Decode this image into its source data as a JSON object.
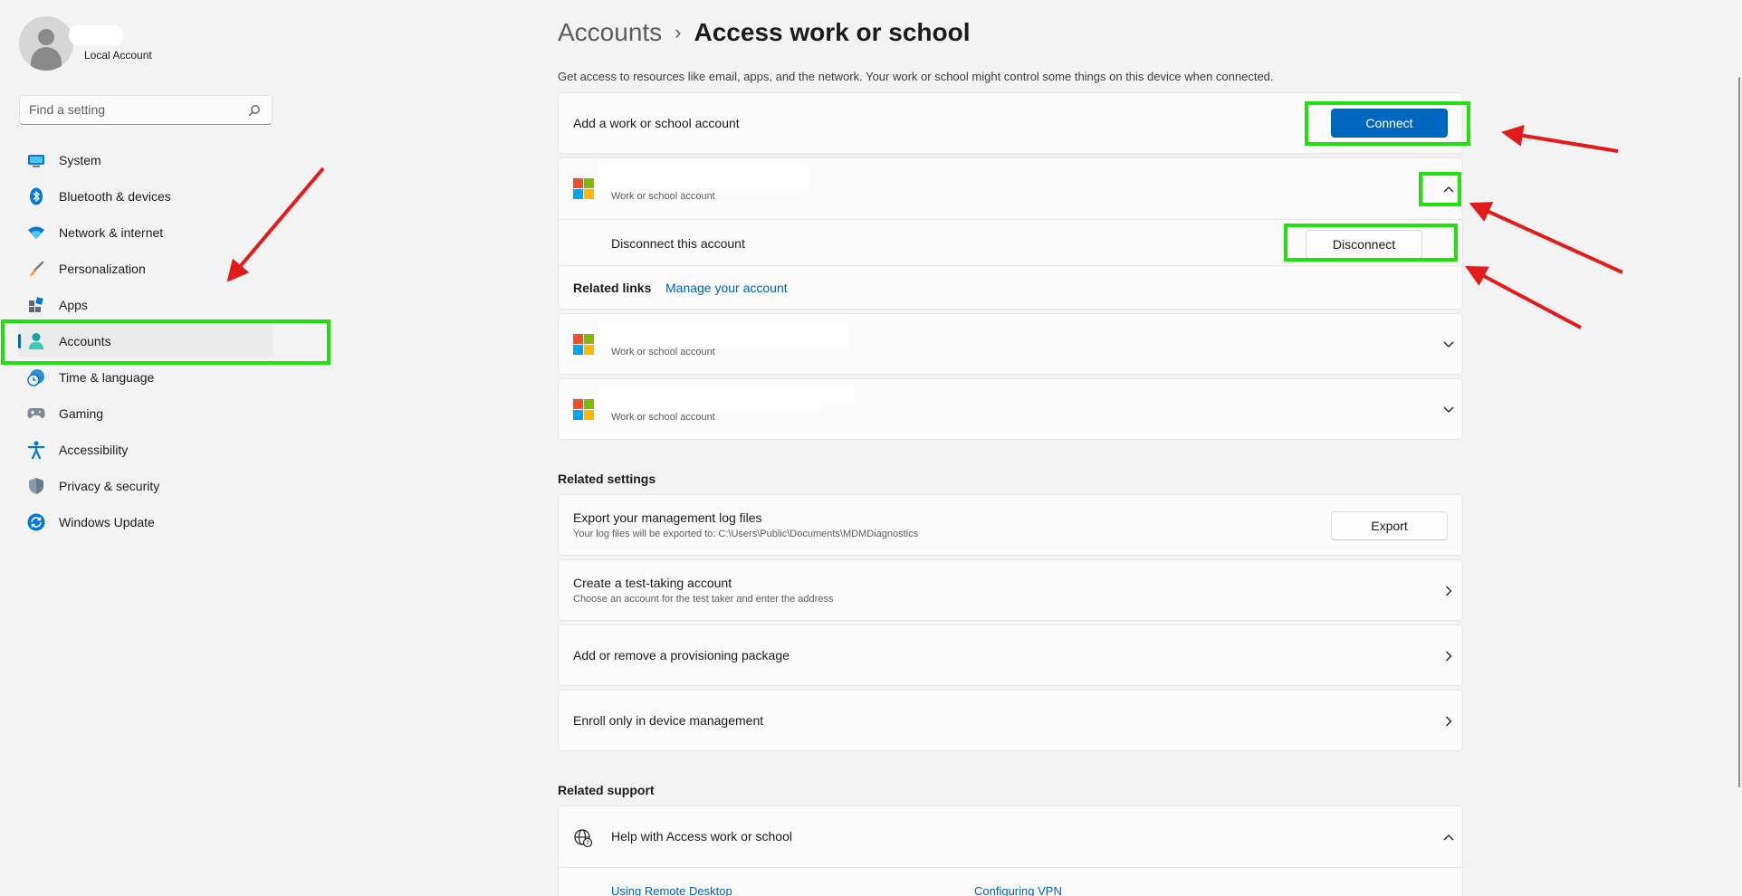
{
  "user": {
    "account_type": "Local Account"
  },
  "search": {
    "placeholder": "Find a setting"
  },
  "sidebar": {
    "items": [
      {
        "label": "System",
        "icon": "system-icon"
      },
      {
        "label": "Bluetooth & devices",
        "icon": "bluetooth-icon"
      },
      {
        "label": "Network & internet",
        "icon": "wifi-icon"
      },
      {
        "label": "Personalization",
        "icon": "brush-icon"
      },
      {
        "label": "Apps",
        "icon": "apps-icon"
      },
      {
        "label": "Accounts",
        "icon": "accounts-icon",
        "active": true
      },
      {
        "label": "Time & language",
        "icon": "clock-globe-icon"
      },
      {
        "label": "Gaming",
        "icon": "gamepad-icon"
      },
      {
        "label": "Accessibility",
        "icon": "accessibility-icon"
      },
      {
        "label": "Privacy & security",
        "icon": "shield-icon"
      },
      {
        "label": "Windows Update",
        "icon": "update-icon"
      }
    ]
  },
  "header": {
    "parent": "Accounts",
    "separator": "›",
    "current": "Access work or school",
    "description": "Get access to resources like email, apps, and the network. Your work or school might control some things on this device when connected."
  },
  "add_account": {
    "label": "Add a work or school account",
    "button": "Connect"
  },
  "accounts": [
    {
      "subtitle": "Work or school account",
      "expanded": true
    },
    {
      "subtitle": "Work or school account",
      "expanded": false
    },
    {
      "subtitle": "Work or school account",
      "expanded": false
    }
  ],
  "expanded_account": {
    "disconnect_label": "Disconnect this account",
    "disconnect_button": "Disconnect",
    "related_links_label": "Related links",
    "manage_link": "Manage your account"
  },
  "related_settings": {
    "heading": "Related settings",
    "items": [
      {
        "title": "Export your management log files",
        "subtitle": "Your log files will be exported to: C:\\Users\\Public\\Documents\\MDMDiagnostics",
        "button": "Export"
      },
      {
        "title": "Create a test-taking account",
        "subtitle": "Choose an account for the test taker and enter the address"
      },
      {
        "title": "Add or remove a provisioning package"
      },
      {
        "title": "Enroll only in device management"
      }
    ]
  },
  "related_support": {
    "heading": "Related support",
    "help_title": "Help with Access work or school",
    "links": [
      "Using Remote Desktop",
      "Configuring VPN"
    ]
  },
  "colors": {
    "accent": "#0067c0",
    "highlight": "#22e00b",
    "arrow": "#e21a1a"
  }
}
